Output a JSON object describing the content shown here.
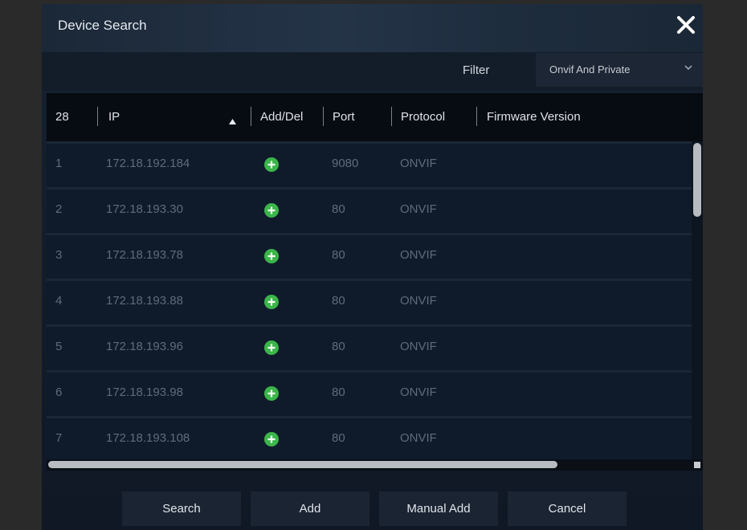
{
  "dialog": {
    "title": "Device Search",
    "close_icon": "close-icon"
  },
  "filter": {
    "label": "Filter",
    "selected": "Onvif And Private"
  },
  "table": {
    "count": "28",
    "headers": {
      "ip": "IP",
      "add_del": "Add/Del",
      "port": "Port",
      "protocol": "Protocol",
      "firmware": "Firmware Version"
    },
    "rows": [
      {
        "no": "1",
        "ip": "172.18.192.184",
        "port": "9080",
        "protocol": "ONVIF",
        "firmware": ""
      },
      {
        "no": "2",
        "ip": "172.18.193.30",
        "port": "80",
        "protocol": "ONVIF",
        "firmware": ""
      },
      {
        "no": "3",
        "ip": "172.18.193.78",
        "port": "80",
        "protocol": "ONVIF",
        "firmware": ""
      },
      {
        "no": "4",
        "ip": "172.18.193.88",
        "port": "80",
        "protocol": "ONVIF",
        "firmware": ""
      },
      {
        "no": "5",
        "ip": "172.18.193.96",
        "port": "80",
        "protocol": "ONVIF",
        "firmware": ""
      },
      {
        "no": "6",
        "ip": "172.18.193.98",
        "port": "80",
        "protocol": "ONVIF",
        "firmware": ""
      },
      {
        "no": "7",
        "ip": "172.18.193.108",
        "port": "80",
        "protocol": "ONVIF",
        "firmware": ""
      }
    ]
  },
  "buttons": {
    "search": "Search",
    "add": "Add",
    "manual_add": "Manual Add",
    "cancel": "Cancel"
  },
  "colors": {
    "add_icon": "#3cb54a",
    "background": "#0f1b2b"
  }
}
